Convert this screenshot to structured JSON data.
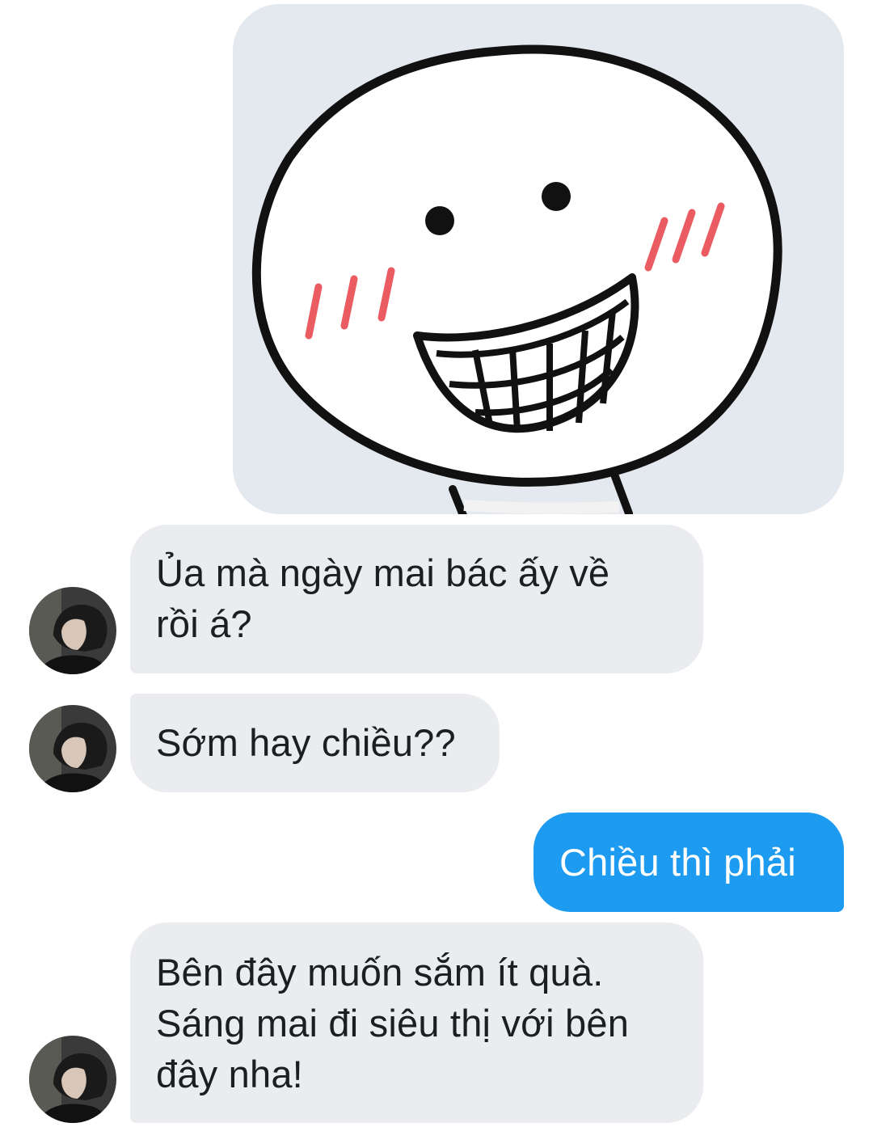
{
  "conversation": {
    "messages": [
      {
        "direction": "outgoing",
        "type": "sticker",
        "sticker_icon": "grinning-blushing-face-sticker"
      },
      {
        "direction": "incoming",
        "type": "text",
        "lines": [
          "Ủa mà ngày mai bác ấy về",
          "rồi á?"
        ]
      },
      {
        "direction": "incoming",
        "type": "text",
        "lines": [
          "Sớm hay chiều??"
        ]
      },
      {
        "direction": "outgoing",
        "type": "text",
        "lines": [
          "Chiều thì phải"
        ]
      },
      {
        "direction": "incoming",
        "type": "text",
        "lines": [
          "Bên đây muốn sắm ít quà.",
          "Sáng mai đi siêu thị với bên",
          "đây nha!"
        ]
      }
    ]
  },
  "colors": {
    "incoming_bubble": "#eaecf0",
    "outgoing_bubble": "#1d9bf0",
    "sticker_background": "#e4e8ef",
    "blush": "#ea5b62"
  }
}
